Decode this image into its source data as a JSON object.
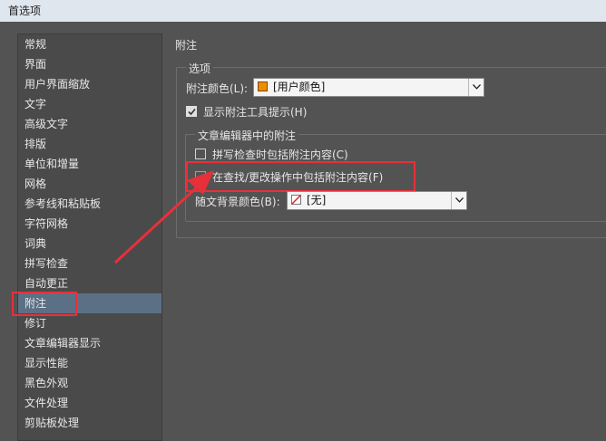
{
  "window": {
    "title": "首选项"
  },
  "sidebar": {
    "items": [
      {
        "label": "常规"
      },
      {
        "label": "界面"
      },
      {
        "label": "用户界面缩放"
      },
      {
        "label": "文字"
      },
      {
        "label": "高级文字"
      },
      {
        "label": "排版"
      },
      {
        "label": "单位和增量"
      },
      {
        "label": "网格"
      },
      {
        "label": "参考线和粘贴板"
      },
      {
        "label": "字符网格"
      },
      {
        "label": "词典"
      },
      {
        "label": "拼写检查"
      },
      {
        "label": "自动更正"
      },
      {
        "label": "附注",
        "selected": true
      },
      {
        "label": "修订"
      },
      {
        "label": "文章编辑器显示"
      },
      {
        "label": "显示性能"
      },
      {
        "label": "黑色外观"
      },
      {
        "label": "文件处理"
      },
      {
        "label": "剪贴板处理"
      }
    ]
  },
  "panel": {
    "title": "附注",
    "options_group": {
      "label": "选项",
      "note_color": {
        "label": "附注颜色(L):",
        "value": "[用户颜色]",
        "swatch_color": "#f08c00"
      },
      "show_tool_tips": {
        "label": "显示附注工具提示(H)",
        "checked": true
      }
    },
    "story_editor_group": {
      "label": "文章编辑器中的附注",
      "spell_check": {
        "label": "拼写检查时包括附注内容(C)",
        "checked": false
      },
      "find_change": {
        "label": "在查找/更改操作中包括附注内容(F)",
        "checked": false
      },
      "bg_color": {
        "label": "随文背景颜色(B):",
        "value": "[无]"
      }
    }
  },
  "colors": {
    "highlight": "#e8303a",
    "selection": "#5c7085"
  }
}
